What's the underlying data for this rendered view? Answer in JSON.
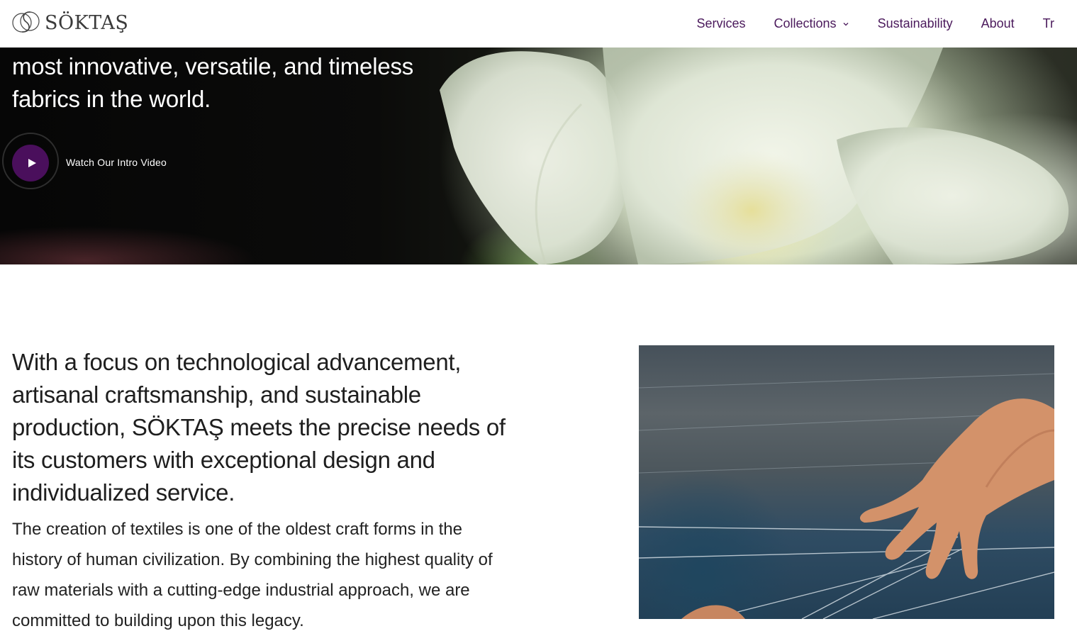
{
  "header": {
    "logo_text": "SÖKTAŞ",
    "nav": [
      {
        "label": "Services"
      },
      {
        "label": "Collections",
        "has_dropdown": true
      },
      {
        "label": "Sustainability"
      },
      {
        "label": "About"
      },
      {
        "label": "Tr"
      }
    ]
  },
  "hero": {
    "lines": [
      "most innovative, versatile, and timeless",
      "fabrics in the world."
    ],
    "video_label": "Watch Our Intro Video"
  },
  "intro": {
    "heading_lines": [
      "With a focus on technological advancement,",
      "artisanal craftsmanship, and sustainable",
      "production, SÖKTAŞ meets the precise needs of",
      "its customers with exceptional design and",
      "individualized service."
    ],
    "body_lines": [
      "The creation of textiles is one of the oldest craft forms in the",
      "history of human civilization. By combining the highest quality of",
      "raw materials with a cutting-edge industrial approach, we are",
      "committed to building upon this legacy."
    ]
  },
  "colors": {
    "accent": "#4b1a5c",
    "play_button": "#4a0f5c"
  },
  "icons": [
    "logo-monogram-icon",
    "chevron-down-icon",
    "play-icon"
  ]
}
